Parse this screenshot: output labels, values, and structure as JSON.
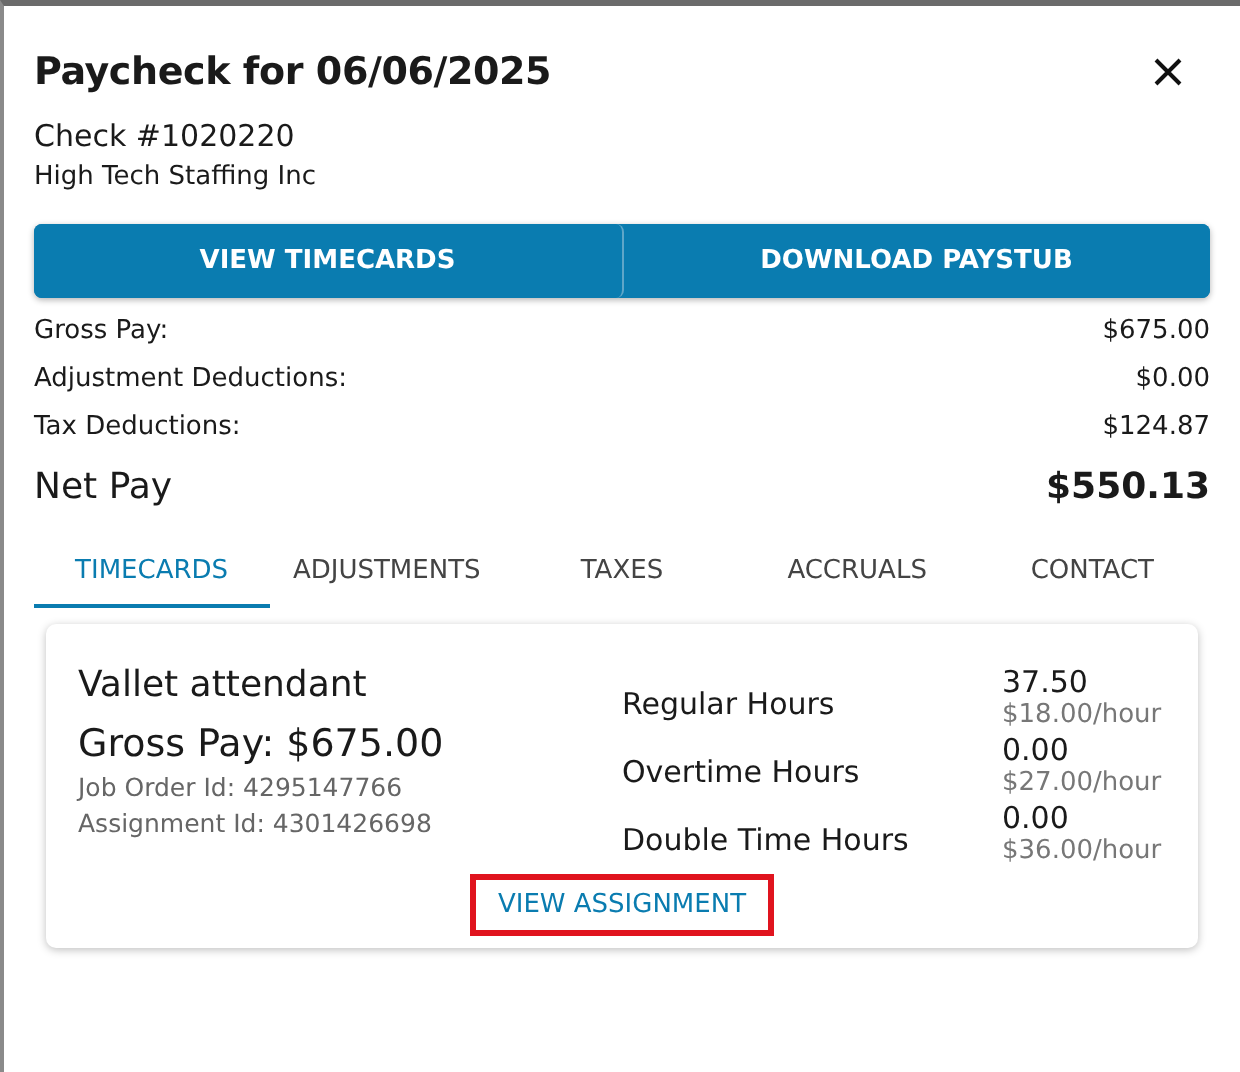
{
  "dialog": {
    "title": "Paycheck for 06/06/2025",
    "check_number": "Check #1020220",
    "company": "High Tech Staffing Inc"
  },
  "actions": [
    "VIEW TIMECARDS",
    "DOWNLOAD PAYSTUB"
  ],
  "summary": [
    {
      "label": "Gross Pay:",
      "value": "$675.00"
    },
    {
      "label": "Adjustment Deductions:",
      "value": "$0.00"
    },
    {
      "label": "Tax Deductions:",
      "value": "$124.87"
    }
  ],
  "net_pay": {
    "label": "Net Pay",
    "value": "$550.13"
  },
  "tabs": [
    {
      "label": "TIMECARDS",
      "selected": true
    },
    {
      "label": "ADJUSTMENTS",
      "selected": false
    },
    {
      "label": "TAXES",
      "selected": false
    },
    {
      "label": "ACCRUALS",
      "selected": false
    },
    {
      "label": "CONTACT",
      "selected": false
    }
  ],
  "timecard": {
    "job": "Vallet attendant",
    "gross_pay": "Gross Pay: $675.00",
    "job_order": "Job Order Id: 4295147766",
    "assignment": "Assignment Id: 4301426698",
    "hours": [
      {
        "label": "Regular Hours",
        "hours": "37.50",
        "rate": "$18.00/hour"
      },
      {
        "label": "Overtime Hours",
        "hours": "0.00",
        "rate": "$27.00/hour"
      },
      {
        "label": "Double Time Hours",
        "hours": "0.00",
        "rate": "$36.00/hour"
      }
    ],
    "link": {
      "label": "VIEW ASSIGNMENT",
      "highlighted": true
    }
  }
}
